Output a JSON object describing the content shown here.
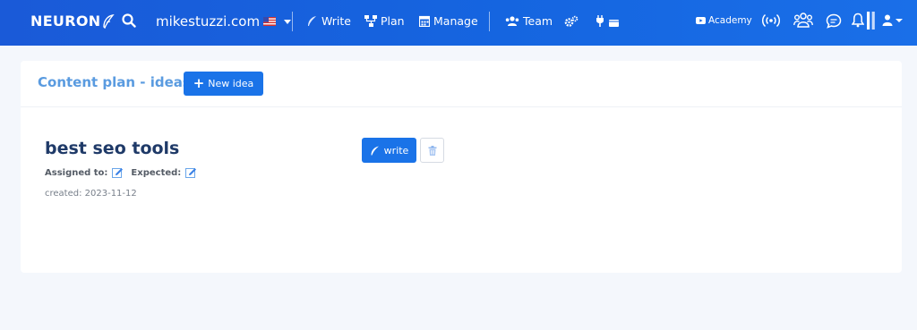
{
  "topbar": {
    "logo_text": "NEURON",
    "domain": "mikestuzzi.com",
    "nav": {
      "write": "Write",
      "plan": "Plan",
      "manage": "Manage",
      "team": "Team"
    },
    "academy": "Academy",
    "colors": {
      "bar": "#1565e0"
    }
  },
  "card": {
    "title": "Content plan - ideas",
    "new_idea_label": "New idea",
    "idea": {
      "title": "best seo tools",
      "assigned_label": "Assigned to:",
      "expected_label": "Expected:",
      "created": "created: 2023-11-12",
      "write_label": "write"
    }
  },
  "colors": {
    "accent": "#1a73e8",
    "title_blue": "#5a9be0",
    "dark_title": "#1f3a68",
    "background": "#f4f7fc"
  }
}
